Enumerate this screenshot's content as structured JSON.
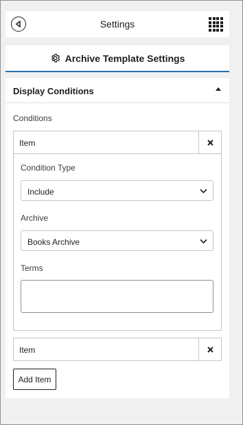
{
  "header": {
    "title": "Settings",
    "back_icon": "back-circle-icon",
    "apps_icon": "grid-menu-icon"
  },
  "tab": {
    "label": "Archive Template Settings",
    "icon": "gear-icon",
    "accent_color": "#2271b1"
  },
  "section": {
    "title": "Display Conditions",
    "conditions_label": "Conditions",
    "items": [
      {
        "label": "Item",
        "expanded": true,
        "fields": {
          "condition_type_label": "Condition Type",
          "condition_type_value": "Include",
          "archive_label": "Archive",
          "archive_value": "Books Archive",
          "terms_label": "Terms",
          "terms_value": ""
        }
      },
      {
        "label": "Item",
        "expanded": false
      }
    ],
    "add_item_label": "Add Item"
  }
}
